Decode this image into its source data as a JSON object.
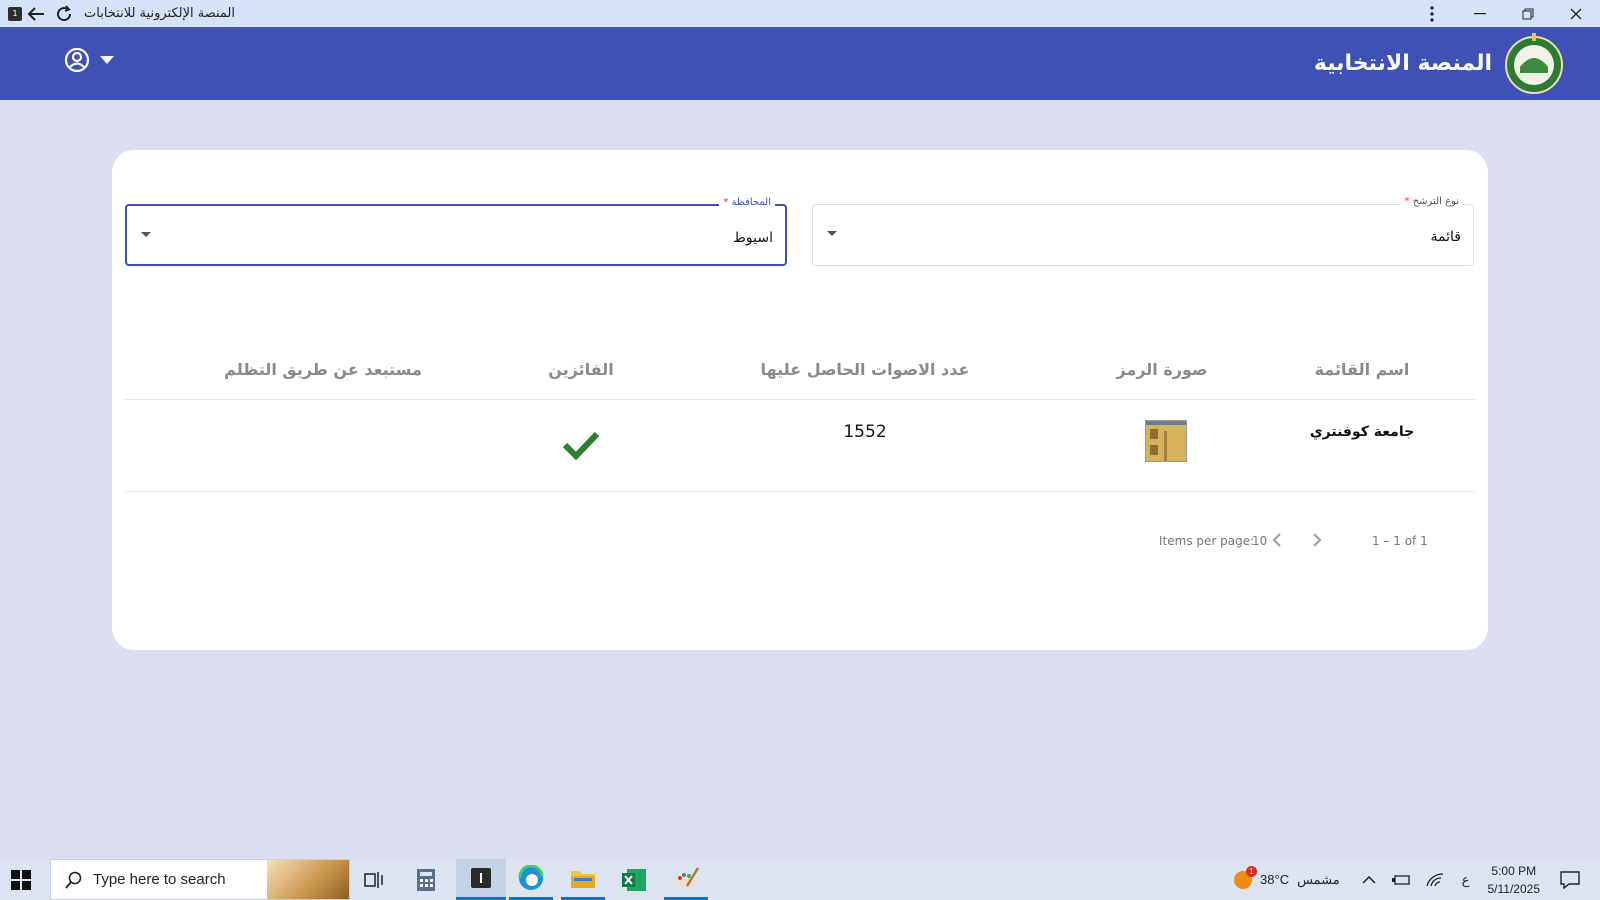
{
  "window": {
    "title": "المنصة الإلكترونية للانتخابات",
    "app_badge": "1"
  },
  "header": {
    "title": "المنصة الانتخابية",
    "logo": "ministry-seal-logo",
    "user_icon": "account-circle-icon",
    "menu_icon": "caret-down-icon",
    "bg_color": "#3f51b5"
  },
  "filters": {
    "candidacy_type": {
      "label": "نوع الترشح",
      "required_mark": "*",
      "value": "قائمة"
    },
    "governorate": {
      "label": "المحافظة",
      "required_mark": "*",
      "value": "اسيوط"
    }
  },
  "table": {
    "headers": {
      "list_name": "اسم القائمة",
      "symbol_image": "صورة الرمز",
      "votes": "عدد الاصوات الحاصل عليها",
      "winners": "الفائزين",
      "excluded": "مستبعد عن طريق التظلم"
    },
    "rows": [
      {
        "list_name": "جامعة كوفنتري",
        "symbol_image": "building-photo",
        "votes": "1552",
        "winner": true,
        "excluded": ""
      }
    ],
    "check_color": "#2e7d32"
  },
  "paginator": {
    "items_per_page_label": "Items per page:",
    "items_per_page_value": "10",
    "range_label": "1 – 1 of 1"
  },
  "taskbar": {
    "search_placeholder": "Type here to search",
    "weather_temp": "38°C",
    "weather_text": "مشمس",
    "weather_badge": "1",
    "lang": "ع",
    "time": "5:00 PM",
    "date": "5/11/2025"
  }
}
